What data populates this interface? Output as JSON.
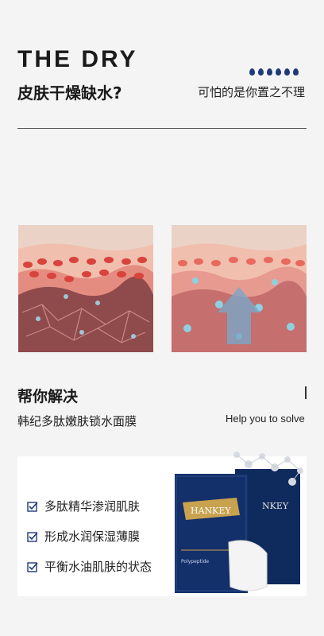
{
  "header": {
    "title_en": "THE DRY",
    "title_cn": "皮肤干燥缺水?",
    "subtitle_right": "可怕的是你置之不理",
    "drop_count": 6,
    "accent_color": "#1e3a7a"
  },
  "solve": {
    "title": "帮你解决",
    "subtitle": "韩纪多肽嫩肤锁水面膜",
    "subtitle_en": "Help you to solve"
  },
  "features": [
    {
      "label": "多肽精华渗润肌肤"
    },
    {
      "label": "形成水润保湿薄膜"
    },
    {
      "label": "平衡水油肌肤的状态"
    }
  ],
  "product": {
    "brand": "HANKEY",
    "brand_back": "NKEY",
    "label_small": "Polypeptide"
  }
}
